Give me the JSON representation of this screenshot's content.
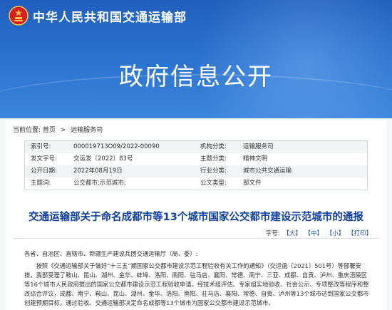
{
  "header": {
    "ministry_name": "中华人民共和国交通运输部",
    "page_title": "政府信息公开"
  },
  "breadcrumb": {
    "label": "当前位置:",
    "items": [
      "首页",
      "运输服务司"
    ],
    "separator": ">"
  },
  "meta": {
    "rows": [
      {
        "k1": "索引号:",
        "v1": "000019713O09/2022-00090",
        "k2": "机构分类:",
        "v2": "运输服务司"
      },
      {
        "k1": "发文字号:",
        "v1": "交运发〔2022〕83号",
        "k2": "主题分类:",
        "v2": "精神文明"
      },
      {
        "k1": "公开日期:",
        "v1": "2022年08月19日",
        "k2": "行业分类:",
        "v2": "城市公共交通运输"
      },
      {
        "k1": "主题词:",
        "v1": "公交都市;示范城市;",
        "k2": "公文类型:",
        "v2": "部文件"
      }
    ]
  },
  "document": {
    "title": "交通运输部关于命名成都市等13个城市国家公交都市建设示范城市的通报",
    "font_size": {
      "label": "字号:",
      "large": "【大】",
      "medium": "【中】",
      "small": "【小】",
      "print": "【打印】"
    },
    "salutation": "各省、自治区、直辖市、新疆生产建设兵团交通运输厅（局、委）:",
    "body": "按照《交通运输部关于做好“十三五”期国家公交都市建设示范工程验收有关工作的通知》（交运函〔2021〕501号）等部署安排，我部受理了鞍山、昆山、湖州、金华、蚌埠、洛阳、南阳、驻马店、襄阳、常德、南宁、三亚、成都、自贡、泸州、重庆涪陵区等16个城市人民政府提出的国家公交都市建设示范工程验收申请。经技术组评估、专家组实地验收、社会公示、专项整改等程序和整改综合评议，成都、南宁、鞍山、昆山、湖州、金华、洛阳、南阳、驻马店、襄阳、常德、自贡、泸州等13个城市达到国家公交都市创建预期目标，通过验收。交通运输部决定命名成都等13个城市为国家公交都市建设示范城市。"
  },
  "colors": {
    "banner": "#2a71cf",
    "title_blue": "#0e3fa0"
  }
}
